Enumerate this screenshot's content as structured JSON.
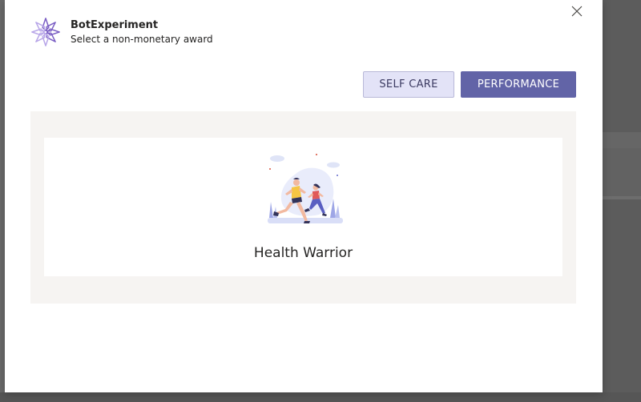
{
  "dialog": {
    "app_name": "BotExperiment",
    "subtitle": "Select a non-monetary award",
    "close_icon": "close-icon"
  },
  "tabs": [
    {
      "label": "SELF CARE",
      "selected": false
    },
    {
      "label": "PERFORMANCE",
      "selected": true
    }
  ],
  "awards": [
    {
      "name": "Health Warrior",
      "icon": "runners-illustration"
    }
  ],
  "colors": {
    "accent": "#6264a7",
    "tab_light_bg": "#e3e3f7",
    "panel_bg": "#f6f4f2"
  }
}
